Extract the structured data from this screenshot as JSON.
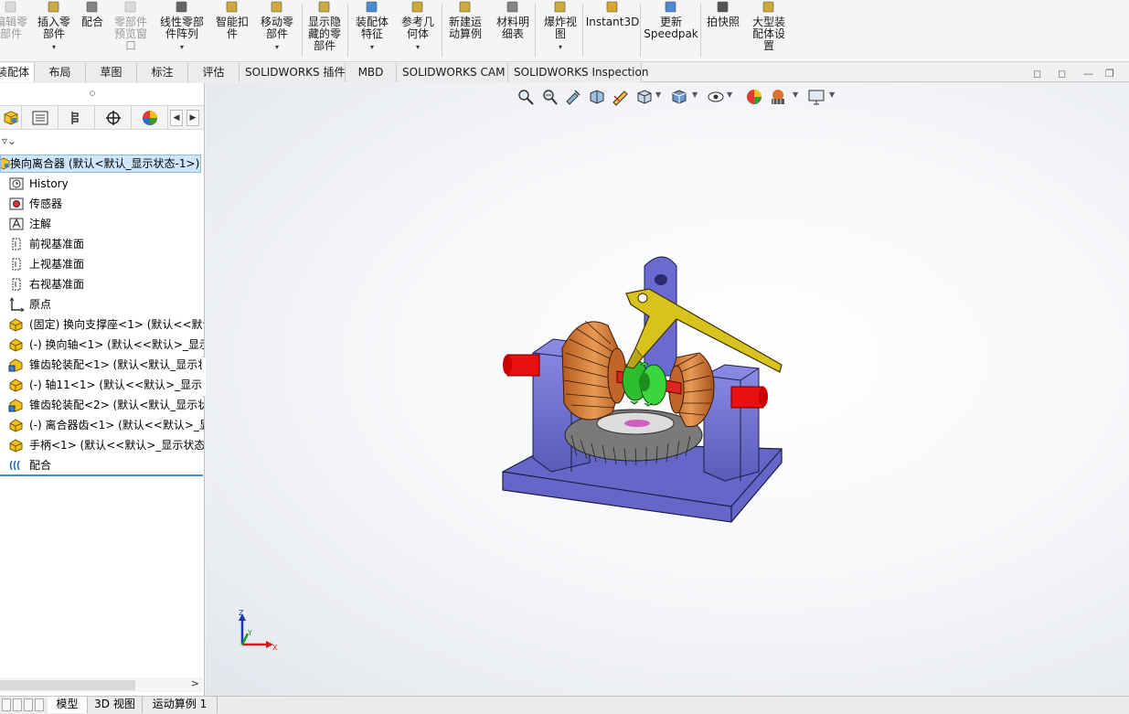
{
  "ribbon": {
    "buttons": [
      {
        "label": "编辑零部件",
        "lines": [
          "编辑零",
          "部件"
        ],
        "disabled": true
      },
      {
        "label": "插入零部件",
        "lines": [
          "插入零",
          "部件"
        ],
        "dropdown": true
      },
      {
        "label": "配合",
        "lines": [
          "配合"
        ]
      },
      {
        "label": "零部件预览窗口",
        "lines": [
          "零部件",
          "预览窗",
          "口"
        ],
        "disabled": true
      },
      {
        "label": "线性零部件阵列",
        "lines": [
          "线性零部",
          "件阵列"
        ],
        "dropdown": true
      },
      {
        "label": "智能扣件",
        "lines": [
          "智能扣",
          "件"
        ]
      },
      {
        "label": "移动零部件",
        "lines": [
          "移动零",
          "部件"
        ],
        "dropdown": true
      },
      {
        "label": "显示隐藏的零部件",
        "lines": [
          "显示隐",
          "藏的零",
          "部件"
        ]
      },
      {
        "label": "装配体特征",
        "lines": [
          "装配体",
          "特征"
        ],
        "dropdown": true
      },
      {
        "label": "参考几何体",
        "lines": [
          "参考几",
          "何体"
        ],
        "dropdown": true
      },
      {
        "label": "新建运动算例",
        "lines": [
          "新建运",
          "动算例"
        ]
      },
      {
        "label": "材料明细表",
        "lines": [
          "材料明",
          "细表"
        ]
      },
      {
        "label": "爆炸视图",
        "lines": [
          "爆炸视",
          "图"
        ],
        "dropdown": true
      },
      {
        "label": "Instant3D",
        "lines": [
          "Instant3D"
        ]
      },
      {
        "label": "更新Speedpak",
        "lines": [
          "更新",
          "Speedpak"
        ]
      },
      {
        "label": "拍快照",
        "lines": [
          "拍快照"
        ]
      },
      {
        "label": "大型装配体设置",
        "lines": [
          "大型装",
          "配体设",
          "置"
        ]
      }
    ]
  },
  "tabs": [
    "装配体",
    "布局",
    "草图",
    "标注",
    "评估",
    "SOLIDWORKS 插件",
    "MBD",
    "SOLIDWORKS CAM",
    "SOLIDWORKS Inspection"
  ],
  "tree": {
    "root": "换向离合器 (默认<默认_显示状态-1>)",
    "items": [
      {
        "label": "History",
        "icon": "history-icon"
      },
      {
        "label": "传感器",
        "icon": "sensor-icon"
      },
      {
        "label": "注解",
        "icon": "annotation-icon"
      },
      {
        "label": "前视基准面",
        "icon": "plane-icon"
      },
      {
        "label": "上视基准面",
        "icon": "plane-icon"
      },
      {
        "label": "右视基准面",
        "icon": "plane-icon"
      },
      {
        "label": "原点",
        "icon": "origin-icon"
      },
      {
        "label": "(固定) 换向支撑座<1> (默认<<默认",
        "icon": "part-icon"
      },
      {
        "label": "(-) 换向轴<1> (默认<<默认>_显示",
        "icon": "part-icon"
      },
      {
        "label": "锥齿轮装配<1> (默认<默认_显示状",
        "icon": "subassembly-icon"
      },
      {
        "label": "(-) 轴11<1> (默认<<默认>_显示状",
        "icon": "part-icon"
      },
      {
        "label": "锥齿轮装配<2> (默认<默认_显示状",
        "icon": "subassembly-icon"
      },
      {
        "label": "(-) 离合器齿<1> (默认<<默认>_显",
        "icon": "part-icon"
      },
      {
        "label": "手柄<1> (默认<<默认>_显示状态",
        "icon": "part-icon"
      },
      {
        "label": "配合",
        "icon": "mates-icon"
      }
    ]
  },
  "triad": {
    "z": "Z",
    "y": "Y",
    "x": "X"
  },
  "bottom_tabs": [
    "模型",
    "3D 视图",
    "运动算例 1"
  ]
}
